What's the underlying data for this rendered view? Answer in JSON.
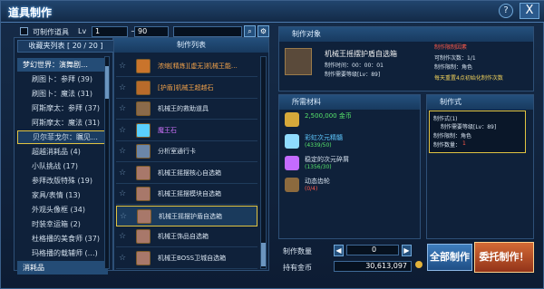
{
  "window": {
    "title": "道具制作",
    "help_label": "?",
    "close_label": "X"
  },
  "filter": {
    "makeable_label": "可制作道具",
    "level_label": "Lv",
    "level_min": "1",
    "level_sep": "~",
    "level_max": "90",
    "search_value": ""
  },
  "categories": {
    "header": "收藏夹列表 [ 20 / 20 ]",
    "items": [
      {
        "label": "梦幻世界：演舞剧…",
        "type": "group"
      },
      {
        "label": "刷图卜：参拜 (39)",
        "type": "item"
      },
      {
        "label": "刷图卜：魔法 (31)",
        "type": "item"
      },
      {
        "label": "阿斯摩太：参拜 (37)",
        "type": "item"
      },
      {
        "label": "阿斯摩太：魔法 (31)",
        "type": "item"
      },
      {
        "label": "贝尔菲戈尔：瞩见…",
        "type": "selected"
      },
      {
        "label": "超越消耗品 (4)",
        "type": "item"
      },
      {
        "label": "小队挑战 (17)",
        "type": "item"
      },
      {
        "label": "参拜改版特殊 (19)",
        "type": "item"
      },
      {
        "label": "家具/表情 (13)",
        "type": "item"
      },
      {
        "label": "外观头像框 (34)",
        "type": "item"
      },
      {
        "label": "时装幸运箱 (2)",
        "type": "item"
      },
      {
        "label": "杜格播的美食师 (37)",
        "type": "item"
      },
      {
        "label": "玛格播的载辅师 (…)",
        "type": "item"
      },
      {
        "label": "消耗品",
        "type": "group"
      }
    ]
  },
  "recipes": {
    "header": "制作列表",
    "items": [
      {
        "name": "浓缩[精炼][虚无]机械王能…",
        "color": "#f2a24a",
        "icon": "#c9742c"
      },
      {
        "name": "[护盾]机械王超越石",
        "color": "#f2a24a",
        "icon": "#b86b2b"
      },
      {
        "name": "机械王的救助道具",
        "color": "#d8e4f0",
        "icon": "#8a6a4a"
      },
      {
        "name": "魔王石",
        "color": "#d173ff",
        "icon": "#5ad0ff"
      },
      {
        "name": "分析室通行卡",
        "color": "#d8e4f0",
        "icon": "#6b86a8"
      },
      {
        "name": "机械王摇摆核心自选箱",
        "color": "#d8e4f0",
        "icon": "#a8786a"
      },
      {
        "name": "机械王摇摆模块自选箱",
        "color": "#d8e4f0",
        "icon": "#a8786a"
      },
      {
        "name": "机械王摇摆护盾自选箱",
        "color": "#d8e4f0",
        "icon": "#a8786a"
      },
      {
        "name": "机械王饰品自选箱",
        "color": "#d8e4f0",
        "icon": "#a8786a"
      },
      {
        "name": "机械王BOSS卫城自选箱",
        "color": "#d8e4f0",
        "icon": "#a8786a"
      }
    ],
    "selected_index": 7
  },
  "target": {
    "header": "制作对象",
    "name": "机械王摇摆护盾自选箱",
    "time_label": "制作时间：00：00：01",
    "level_label": "制作需要等级[Lv：89]",
    "limit_title": "制作限制因素",
    "limit_count": "可制作次数：1/1",
    "limit_job": "制作限制：角色",
    "limit_note": "每天重置4点初始化制作次数"
  },
  "materials": {
    "header": "所需材料",
    "items": [
      {
        "name": "2,500,000 金币",
        "count": "",
        "name_color": "#57e36b",
        "count_color": "#57e36b",
        "icon": "#d6a93a"
      },
      {
        "name": "彩虹次元精髓",
        "count": "(4339/50)",
        "name_color": "#5fc9ff",
        "count_color": "#57e36b",
        "icon": "#8fdcff"
      },
      {
        "name": "稳定的次元碎屑",
        "count": "(1356/30)",
        "name_color": "#d8e4f0",
        "count_color": "#57e36b",
        "icon": "#c46bff"
      },
      {
        "name": "动态齿轮",
        "count": "(0/4)",
        "name_color": "#d8e4f0",
        "count_color": "#ff5a4a",
        "icon": "#8c6a3e"
      }
    ]
  },
  "method": {
    "header": "制作式",
    "line1": "制作式(1)",
    "line2": "制作需要等级[Lv：89]",
    "line3": "制作限制：角色",
    "line4": "制作数量：",
    "line4_value": "1"
  },
  "footer": {
    "qty_label": "制作数量",
    "qty_value": "0",
    "gold_label": "持有金币",
    "gold_value": "30,613,097",
    "make_all_label": "全部制作",
    "commission_label": "委托制作！"
  }
}
